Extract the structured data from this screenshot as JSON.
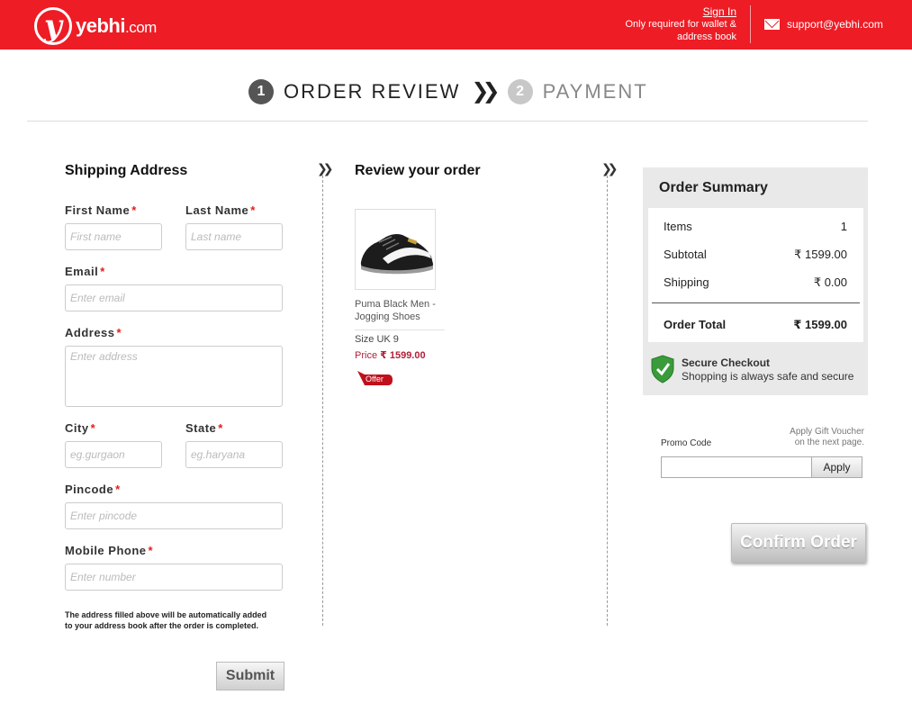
{
  "header": {
    "logo_text": "yebhi",
    "logo_suffix": ".com",
    "signin_label": "Sign In",
    "signin_note_1": "Only required for wallet &",
    "signin_note_2": "address book",
    "support_email": "support@yebhi.com",
    "brand_color": "#ee1c25"
  },
  "steps": [
    {
      "number": "1",
      "label": "ORDER REVIEW",
      "active": true
    },
    {
      "number": "2",
      "label": "PAYMENT",
      "active": false
    }
  ],
  "shipping": {
    "title": "Shipping Address",
    "first_name": {
      "label": "First Name",
      "placeholder": "First name"
    },
    "last_name": {
      "label": "Last Name",
      "placeholder": "Last name"
    },
    "email": {
      "label": "Email",
      "placeholder": "Enter email"
    },
    "address": {
      "label": "Address",
      "placeholder": "Enter address"
    },
    "city": {
      "label": "City",
      "placeholder": "eg.gurgaon"
    },
    "state": {
      "label": "State",
      "placeholder": "eg.haryana"
    },
    "pincode": {
      "label": "Pincode",
      "placeholder": "Enter pincode"
    },
    "mobile": {
      "label": "Mobile Phone",
      "placeholder": "Enter number"
    },
    "required_mark": "*",
    "note_1": "The address filled above will be automatically added",
    "note_2": "to your address book after the order is completed.",
    "submit_label": "Submit"
  },
  "review": {
    "title": "Review your order",
    "product_name_1": "Puma Black Men -",
    "product_name_2": "Jogging Shoes",
    "size_text": "Size  UK 9",
    "price_label": "Price",
    "price_value": "₹ 1599.00",
    "offer_label": "Offer"
  },
  "summary": {
    "title": "Order Summary",
    "items_label": "Items",
    "items_value": "1",
    "subtotal_label": "Subtotal",
    "subtotal_value": "₹  1599.00",
    "shipping_label": "Shipping",
    "shipping_value": "₹  0.00",
    "total_label": "Order Total",
    "total_value": "₹  1599.00",
    "secure_title": "Secure Checkout",
    "secure_sub": "Shopping is always safe and secure"
  },
  "promo": {
    "label": "Promo Code",
    "gift_note_1": "Apply Gift Voucher",
    "gift_note_2": "on the next page.",
    "apply_label": "Apply",
    "value": ""
  },
  "confirm_label": "Confirm Order",
  "icons": [
    "logo-icon",
    "mail-icon",
    "chevron-double-right-icon",
    "shield-check-icon",
    "offer-tag-icon",
    "shoe-image"
  ]
}
